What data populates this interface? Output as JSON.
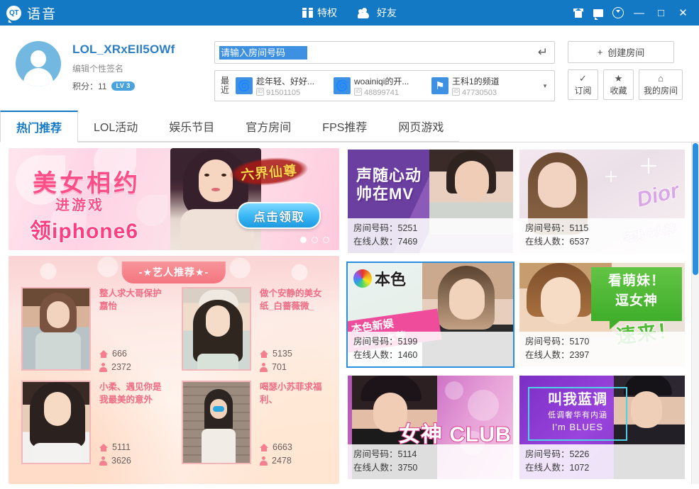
{
  "titlebar": {
    "logo_mark": "QT",
    "app_name": "语音",
    "center_items": [
      {
        "icon": "gift-icon",
        "label": "特权"
      },
      {
        "icon": "friends-icon",
        "label": "好友"
      }
    ],
    "right_icons": [
      "shirt-icon",
      "message-icon",
      "clock-icon"
    ],
    "minimize": "—",
    "maximize": "□",
    "close": "✕"
  },
  "profile": {
    "username": "LOL_XRxEIl5OWf",
    "signature": "编辑个性签名",
    "points_label": "积分：11",
    "level_badge": "LV 3"
  },
  "search": {
    "placeholder": "请输入房间号码",
    "value": "",
    "enter_icon": "↵"
  },
  "recent": {
    "label": "最近",
    "id_tag": "ID",
    "items": [
      {
        "name": "趁年轻、好好...",
        "id": "91501105",
        "glyph": "🌀"
      },
      {
        "name": "woainiqi的开...",
        "id": "48899741",
        "glyph": "🌀"
      },
      {
        "name": "王科1的频道",
        "id": "47730503",
        "glyph": "⚑"
      }
    ],
    "more_arrow": "▾"
  },
  "actions": {
    "create_room": {
      "icon": "plus-icon",
      "label": "创建房间"
    },
    "buttons": [
      {
        "icon": "✓",
        "label": "订阅",
        "name": "subscribe"
      },
      {
        "icon": "★",
        "label": "收藏",
        "name": "favorites"
      },
      {
        "icon": "⌂",
        "label": "我的房间",
        "name": "my-room"
      }
    ]
  },
  "tabs": [
    {
      "label": "热门推荐",
      "active": true
    },
    {
      "label": "LOL活动",
      "active": false
    },
    {
      "label": "娱乐节目",
      "active": false
    },
    {
      "label": "官方房间",
      "active": false
    },
    {
      "label": "FPS推荐",
      "active": false
    },
    {
      "label": "网页游戏",
      "active": false
    }
  ],
  "banner": {
    "title": "美女相约",
    "sub": "进游戏",
    "sub2": "领iphone6",
    "game_logo": "六界仙尊",
    "cta": "点击领取",
    "dots": 3,
    "active_dot": 0
  },
  "artist_panel": {
    "title": "-★艺人推荐★-",
    "items": [
      {
        "name": "整人求大哥保护嘉怡",
        "rooms": "666",
        "viewers": "2372"
      },
      {
        "name": "做个安静的美女纸_白蔷薇微_",
        "rooms": "5135",
        "viewers": "701"
      },
      {
        "name": "小柔、遇见你是我最美的意外",
        "rooms": "5111",
        "viewers": "3626"
      },
      {
        "name": "喝瑟小苏菲求福利、",
        "rooms": "6663",
        "viewers": "2478"
      }
    ]
  },
  "room_cards": [
    {
      "art": "t1",
      "headline": "声随心动\n帅在MV",
      "room_label": "房间号码：5251",
      "online_label": "在线人数：7469",
      "selected": false
    },
    {
      "art": "t2",
      "headline": "Dior 宅男の女神",
      "room_label": "房间号码：5115",
      "online_label": "在线人数：6537",
      "selected": false
    },
    {
      "art": "t3",
      "headline": "本色新娱 女神大本营",
      "room_label": "房间号码：5199",
      "online_label": "在线人数：1460",
      "selected": true
    },
    {
      "art": "t4",
      "headline": "看萌妹！逗女神 速来！",
      "room_label": "房间号码：5170",
      "online_label": "在线人数：2397",
      "selected": false
    },
    {
      "art": "t5",
      "headline": "女神 CLUB",
      "room_label": "房间号码：5114",
      "online_label": "在线人数：3750",
      "selected": false
    },
    {
      "art": "t6",
      "headline": "叫我蓝调 低调奢华有内涵 I'm BLUES",
      "room_label": "房间号码：5226",
      "online_label": "在线人数：1072",
      "selected": false
    }
  ],
  "card_art": {
    "t1_badge_line1": "声随心动",
    "t1_badge_line2": "帅在MV",
    "t2_logo": "Dior",
    "t2_sub": "宅男の女神",
    "t3_logo_text": "本色",
    "t3_ribbon_line1": "本色新娱",
    "t3_ribbon_line2": "女神大本营",
    "t4_line1": "看萌妹！",
    "t4_line2": "逗女神",
    "t4_come": "速来！",
    "t5_club": "女神 CLUB",
    "t6_line1": "叫我蓝调",
    "t6_line2": "低调奢华有内涵",
    "t6_line3": "I'm BLUES"
  },
  "colors": {
    "brand_blue": "#1479c4",
    "accent_pink": "#ef6d84",
    "selected_border": "#2b8fe0"
  }
}
